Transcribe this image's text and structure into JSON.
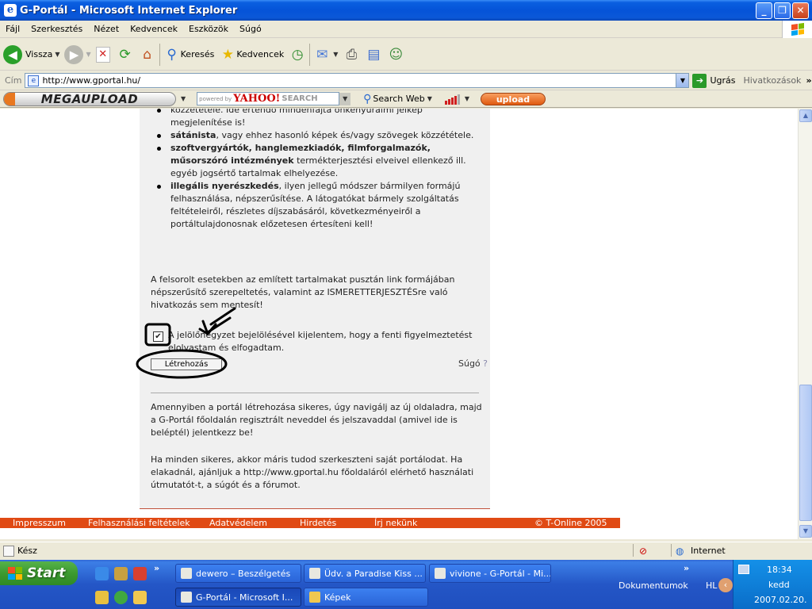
{
  "window": {
    "title": "G-Portál - Microsoft Internet Explorer"
  },
  "menu": [
    "Fájl",
    "Szerkesztés",
    "Nézet",
    "Kedvencek",
    "Eszközök",
    "Súgó"
  ],
  "toolbar": {
    "back": "Vissza",
    "search": "Keresés",
    "favorites": "Kedvencek"
  },
  "address": {
    "label": "Cím",
    "url": "http://www.gportal.hu/",
    "go": "Ugrás",
    "links": "Hivatkozások"
  },
  "megabar": {
    "logo": "MEGAUPLOAD",
    "powered": "powered by",
    "yahoo": "YAHOO!",
    "search_word": "SEARCH",
    "search_web": "Search Web",
    "upload": "upload"
  },
  "content": {
    "items": [
      {
        "plain_before": "",
        "bold": "",
        "text": "közzététele. Ide értendő mindenfajta önkényuralmi jelkép megjelenítése is!"
      },
      {
        "bold": "sátánista",
        "text": ", vagy ehhez hasonló képek és/vagy szövegek közzététele."
      },
      {
        "bold": "szoftvergyártók, hanglemezkiadók, filmforgalmazók, műsorszóró intézmények",
        "text": " termékterjesztési elveivel ellenkező ill. egyéb jogsértő tartalmak elhelyezése."
      },
      {
        "bold": "illegális nyerészkedés",
        "text": ", ilyen jellegű módszer bármilyen formájú felhasználása, népszerűsítése. A látogatókat bármely szolgáltatás feltételeiről, részletes díjszabásáról, következményeiről a portáltulajdonosnak előzetesen értesíteni kell!"
      }
    ],
    "para1": "A felsorolt esetekben az említett tartalmakat pusztán link formájában népszerűsítő szerepeltetés, valamint az ISMERETTERJESZTÉSre való hivatkozás sem mentesít!",
    "check_text": "A jelölőnégyzet bejelölésével kijelentem, hogy a fenti figyelmeztetést elolvastam és elfogadtam.",
    "checkbox_mark": "✔",
    "create_button": "Létrehozás",
    "help": "Súgó",
    "help_mark": "?",
    "para2": "Amennyiben a portál létrehozása sikeres, úgy navigálj az új oldaladra, majd a G-Portál főoldalán regisztrált neveddel és jelszavaddal (amivel ide is beléptél) jelentkezz be!",
    "para3": "Ha minden sikeres, akkor máris tudod szerkeszteni saját portálodat. Ha elakadnál, ajánljuk a http://www.gportal.hu főoldaláról elérhető használati útmutatót-t, a súgót és a fórumot."
  },
  "footer": {
    "links": [
      "Impresszum",
      "Felhasználási feltételek",
      "Adatvédelem",
      "Hirdetés",
      "Írj nekünk"
    ],
    "copyright": "© T-Online 2005"
  },
  "status": {
    "text": "Kész",
    "zone": "Internet"
  },
  "taskbar": {
    "start": "Start",
    "tasks": [
      "dewero – Beszélgetés",
      "Üdv. a Paradise Kiss ...",
      "vivione - G-Portál - Mi...",
      "G-Portál - Microsoft I...",
      "Képek"
    ],
    "documents": "Dokumentumok",
    "lang": "HL",
    "time": "18:34",
    "day": "kedd",
    "date": "2007.02.20."
  },
  "colors": {
    "accent": "#e04a14",
    "title_blue": "#0553d8",
    "start_green": "#3c9a30"
  }
}
